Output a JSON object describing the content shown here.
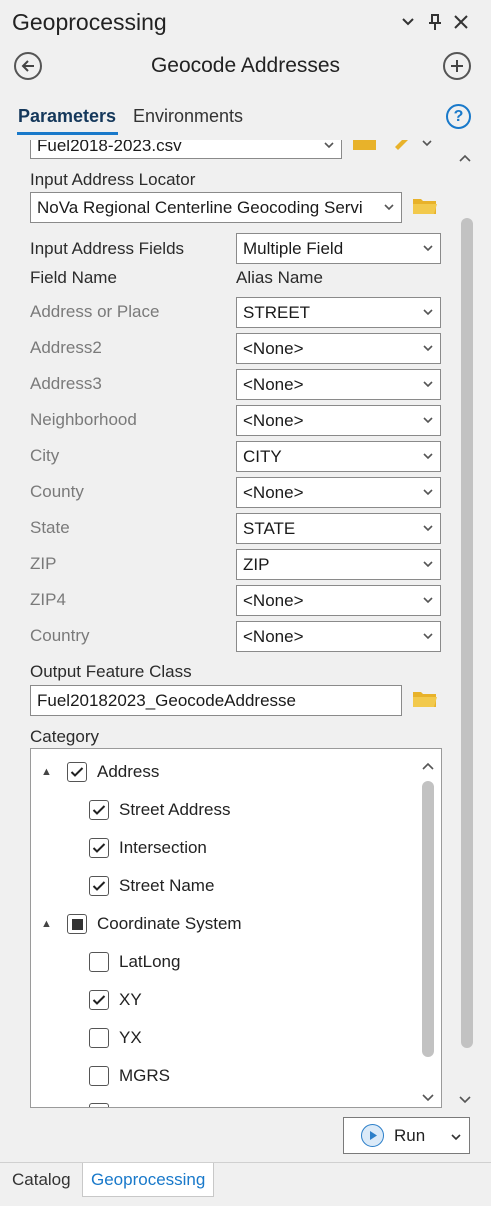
{
  "window": {
    "title": "Geoprocessing",
    "minimize_icon": "chevron-down-icon",
    "pin_icon": "pin-icon",
    "close_icon": "close-icon"
  },
  "tool": {
    "back_icon": "back-arrow-icon",
    "name": "Geocode Addresses",
    "add_icon": "plus-icon"
  },
  "tabs": [
    {
      "label": "Parameters",
      "active": true
    },
    {
      "label": "Environments",
      "active": false
    }
  ],
  "help_label": "?",
  "input_table": {
    "value": "Fuel2018-2023.csv"
  },
  "address_locator": {
    "label": "Input Address Locator",
    "value": "NoVa Regional Centerline Geocoding Servi"
  },
  "address_fields": {
    "label": "Input Address Fields",
    "value": "Multiple Field"
  },
  "field_header": {
    "field_name": "Field Name",
    "alias_name": "Alias Name"
  },
  "field_map": [
    {
      "field": "Address or Place",
      "alias": "STREET"
    },
    {
      "field": "Address2",
      "alias": "<None>"
    },
    {
      "field": "Address3",
      "alias": "<None>"
    },
    {
      "field": "Neighborhood",
      "alias": "<None>"
    },
    {
      "field": "City",
      "alias": "CITY"
    },
    {
      "field": "County",
      "alias": "<None>"
    },
    {
      "field": "State",
      "alias": "STATE"
    },
    {
      "field": "ZIP",
      "alias": "ZIP"
    },
    {
      "field": "ZIP4",
      "alias": "<None>"
    },
    {
      "field": "Country",
      "alias": "<None>"
    }
  ],
  "output": {
    "label": "Output Feature Class",
    "value": "Fuel20182023_GeocodeAddresse"
  },
  "category": {
    "label": "Category",
    "items": [
      {
        "label": "Address",
        "level": 0,
        "state": "checked",
        "expander": "▲"
      },
      {
        "label": "Street Address",
        "level": 1,
        "state": "checked"
      },
      {
        "label": "Intersection",
        "level": 1,
        "state": "checked"
      },
      {
        "label": "Street Name",
        "level": 1,
        "state": "checked"
      },
      {
        "label": "Coordinate System",
        "level": 0,
        "state": "partial",
        "expander": "▲"
      },
      {
        "label": "LatLong",
        "level": 1,
        "state": "unchecked"
      },
      {
        "label": "XY",
        "level": 1,
        "state": "checked"
      },
      {
        "label": "YX",
        "level": 1,
        "state": "unchecked"
      },
      {
        "label": "MGRS",
        "level": 1,
        "state": "unchecked"
      }
    ]
  },
  "run_button": {
    "label": "Run"
  },
  "bottom_tabs": [
    {
      "label": "Catalog",
      "active": false
    },
    {
      "label": "Geoprocessing",
      "active": true
    }
  ],
  "colors": {
    "accent": "#1979ca",
    "background": "#f0f0f0"
  }
}
